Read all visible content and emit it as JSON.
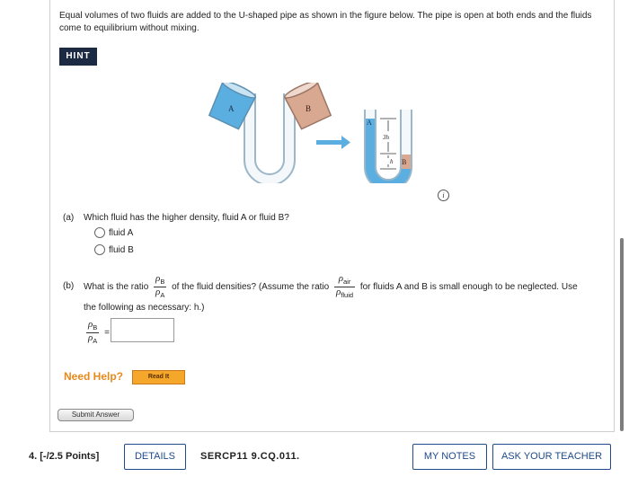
{
  "problem": {
    "intro": "Equal volumes of two fluids are added to the U-shaped pipe as shown in the figure below. The pipe is open at both ends and the fluids come to equilibrium without mixing.",
    "hint_label": "HINT",
    "figure": {
      "label_a": "A",
      "label_b": "B",
      "label_3h": "3h",
      "label_h": "h"
    },
    "info_icon_glyph": "i"
  },
  "part_a": {
    "tag": "(a)",
    "question": "Which fluid has the higher density, fluid A or fluid B?",
    "options": [
      "fluid A",
      "fluid B"
    ]
  },
  "part_b": {
    "tag": "(b)",
    "q_prefix": "What is the ratio",
    "q_mid": "of the fluid densities? (Assume the ratio",
    "q_suffix": "for fluids A and B is small enough to be neglected. Use",
    "q_line2": "the following as necessary: h.)",
    "rho": "ρ",
    "sub_b": "B",
    "sub_a": "A",
    "sub_air": "air",
    "sub_fluid": "fluid",
    "equals": "=",
    "answer_value": ""
  },
  "help": {
    "need_help": "Need Help?",
    "read_it": "Read It"
  },
  "submit_label": "Submit Answer",
  "footer": {
    "question_number": "4.",
    "points": "[-/2.5 Points]",
    "details": "DETAILS",
    "code": "SERCP11 9.CQ.011.",
    "my_notes": "MY NOTES",
    "ask_teacher": "ASK YOUR TEACHER"
  },
  "colors": {
    "hint_bg": "#1d2a44",
    "fluid_a": "#5aaee0",
    "fluid_b": "#d9a890",
    "accent_blue": "#1f4a8a",
    "need_help": "#e8891b",
    "read_it_bg": "#f4a72a"
  }
}
